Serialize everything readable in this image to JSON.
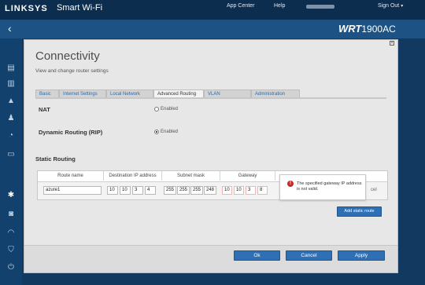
{
  "header": {
    "logo": "LINKSYS",
    "product": "Smart Wi-Fi",
    "nav": [
      "App Center",
      "Help",
      "Sign Out"
    ],
    "model": "WRT",
    "model_number": "1900AC"
  },
  "sidebar": {
    "icons": [
      "bar-chart-icon",
      "device-icon",
      "warning-icon",
      "parental-icon",
      "speed-icon",
      "media-icon",
      "gear-icon",
      "camera-icon",
      "wifi-icon",
      "shield-icon",
      "power-icon"
    ]
  },
  "page": {
    "title": "Connectivity",
    "subtitle": "View and change router settings",
    "tabs": [
      "Basic",
      "Internet Settings",
      "Local Network",
      "Advanced Routing",
      "VLAN",
      "Administration"
    ],
    "active_tab": "Advanced Routing"
  },
  "nat": {
    "label": "NAT",
    "option": "Enabled",
    "selected": false
  },
  "rip": {
    "label": "Dynamic Routing (RIP)",
    "option": "Enabled",
    "selected": true
  },
  "static_routing": {
    "title": "Static Routing",
    "columns": [
      "Route name",
      "Destination IP address",
      "Subnet mask",
      "Gateway"
    ],
    "row": {
      "route_name": "azure1",
      "dest_ip": [
        "10",
        "10",
        "3",
        "4"
      ],
      "subnet": [
        "255",
        "255",
        "255",
        "248"
      ],
      "gateway": [
        "10",
        "10",
        "3",
        "8"
      ]
    },
    "add_button": "Add static route",
    "cancel_fragment": "cel"
  },
  "error_tip": {
    "message": "The specified gateway IP address is not valid."
  },
  "footer": {
    "ok": "Ok",
    "cancel": "Cancel",
    "apply": "Apply"
  }
}
